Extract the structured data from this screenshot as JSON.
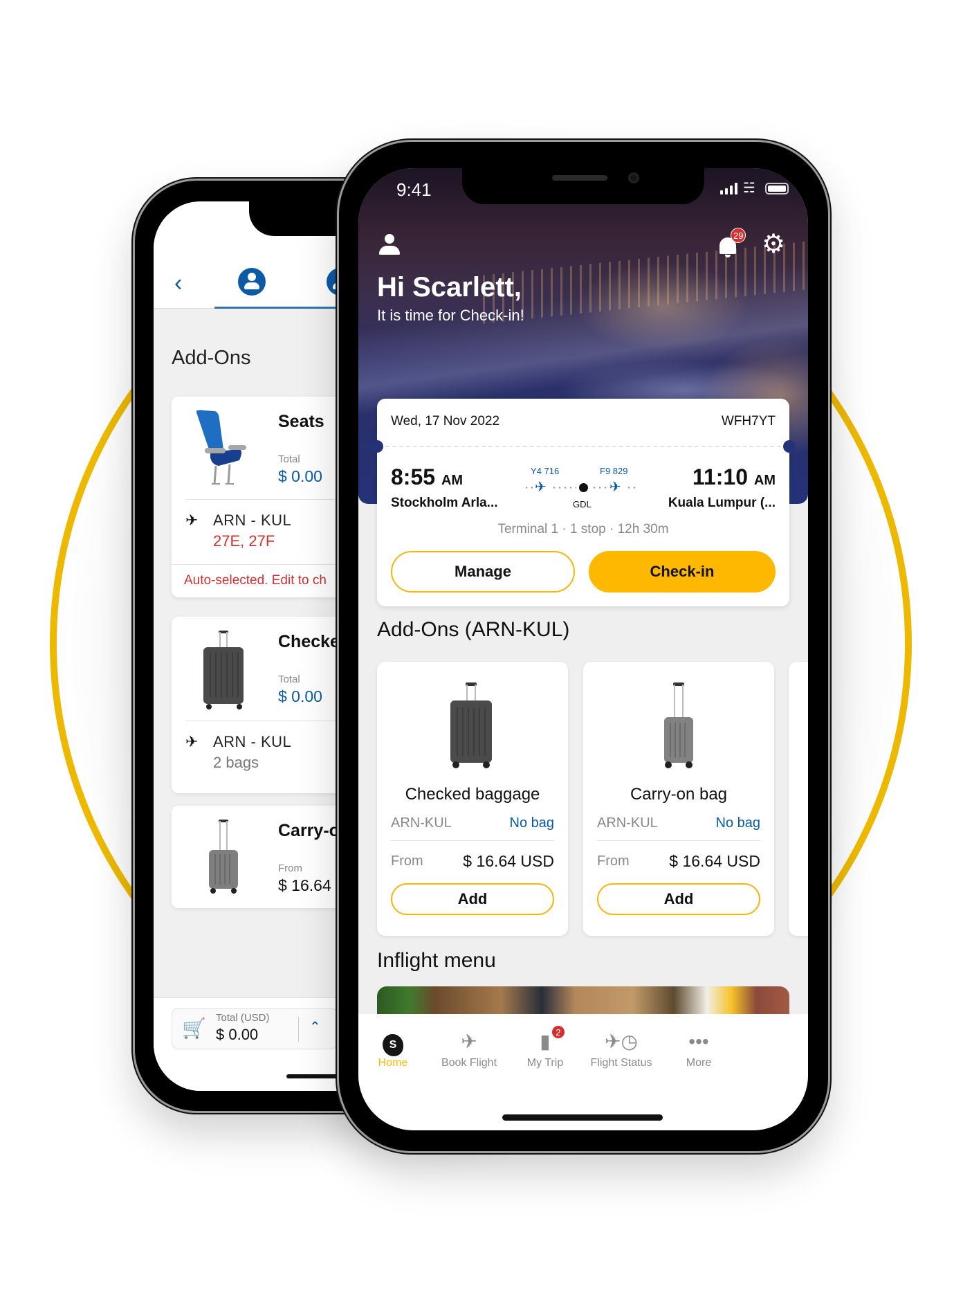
{
  "colors": {
    "accent": "#FFB800",
    "brand_blue": "#0A5AA5",
    "alert_red": "#D32F2F",
    "ring": "#EDB900"
  },
  "back_phone": {
    "nav": {
      "back_icon": "chevron-left-icon",
      "tabs": [
        {
          "icon": "passenger-icon",
          "active": true
        },
        {
          "icon": "group-icon",
          "active": false
        }
      ]
    },
    "section_title": "Add-Ons",
    "cards": [
      {
        "title": "Seats",
        "image": "seat-icon",
        "sub_label": "Total",
        "sub_value": "$ 0.00",
        "route": "ARN - KUL",
        "route_detail": "27E, 27F",
        "notice": "Auto-selected. Edit to ch"
      },
      {
        "title": "Checke",
        "image": "checked-suitcase-icon",
        "sub_label": "Total",
        "sub_value": "$ 0.00",
        "route": "ARN - KUL",
        "route_detail": "2 bags"
      },
      {
        "title": "Carry-o",
        "image": "carry-on-suitcase-icon",
        "sub_label": "From",
        "sub_value": "$ 16.64"
      }
    ],
    "footer": {
      "total_label": "Total (USD)",
      "total_value": "$ 0.00",
      "cart_icon": "cart-icon",
      "expand_icon": "chevron-up-icon"
    }
  },
  "front_phone": {
    "status_bar": {
      "time": "9:41"
    },
    "header": {
      "notifications_count": "29",
      "greeting": "Hi Scarlett,",
      "subtitle": "It is time for Check-in!"
    },
    "trip": {
      "date": "Wed, 17 Nov 2022",
      "pnr": "WFH7YT",
      "departure": {
        "time": "8:55",
        "ampm": "AM",
        "city": "Stockholm Arla..."
      },
      "arrival": {
        "time": "11:10",
        "ampm": "AM",
        "city": "Kuala Lumpur (..."
      },
      "legs": [
        {
          "flight": "Y4 716"
        },
        {
          "flight": "F9 829"
        }
      ],
      "stop_code": "GDL",
      "meta": "Terminal 1  ·  1 stop  ·  12h 30m",
      "manage_label": "Manage",
      "checkin_label": "Check-in"
    },
    "addons_title": "Add-Ons (ARN-KUL)",
    "addons": [
      {
        "name": "Checked baggage",
        "route": "ARN-KUL",
        "status": "No bag",
        "from_label": "From",
        "price": "$ 16.64 USD",
        "button": "Add"
      },
      {
        "name": "Carry-on bag",
        "route": "ARN-KUL",
        "status": "No bag",
        "from_label": "From",
        "price": "$ 16.64 USD",
        "button": "Add"
      }
    ],
    "inflight_title": "Inflight menu",
    "tabbar": [
      {
        "label": "Home",
        "icon": "home-logo-icon",
        "active": true
      },
      {
        "label": "Book Flight",
        "icon": "plane-takeoff-icon",
        "active": false
      },
      {
        "label": "My Trip",
        "icon": "ticket-icon",
        "active": false,
        "badge": "2"
      },
      {
        "label": "Flight Status",
        "icon": "flight-status-icon",
        "active": false
      },
      {
        "label": "More",
        "icon": "more-dots-icon",
        "active": false
      }
    ]
  }
}
